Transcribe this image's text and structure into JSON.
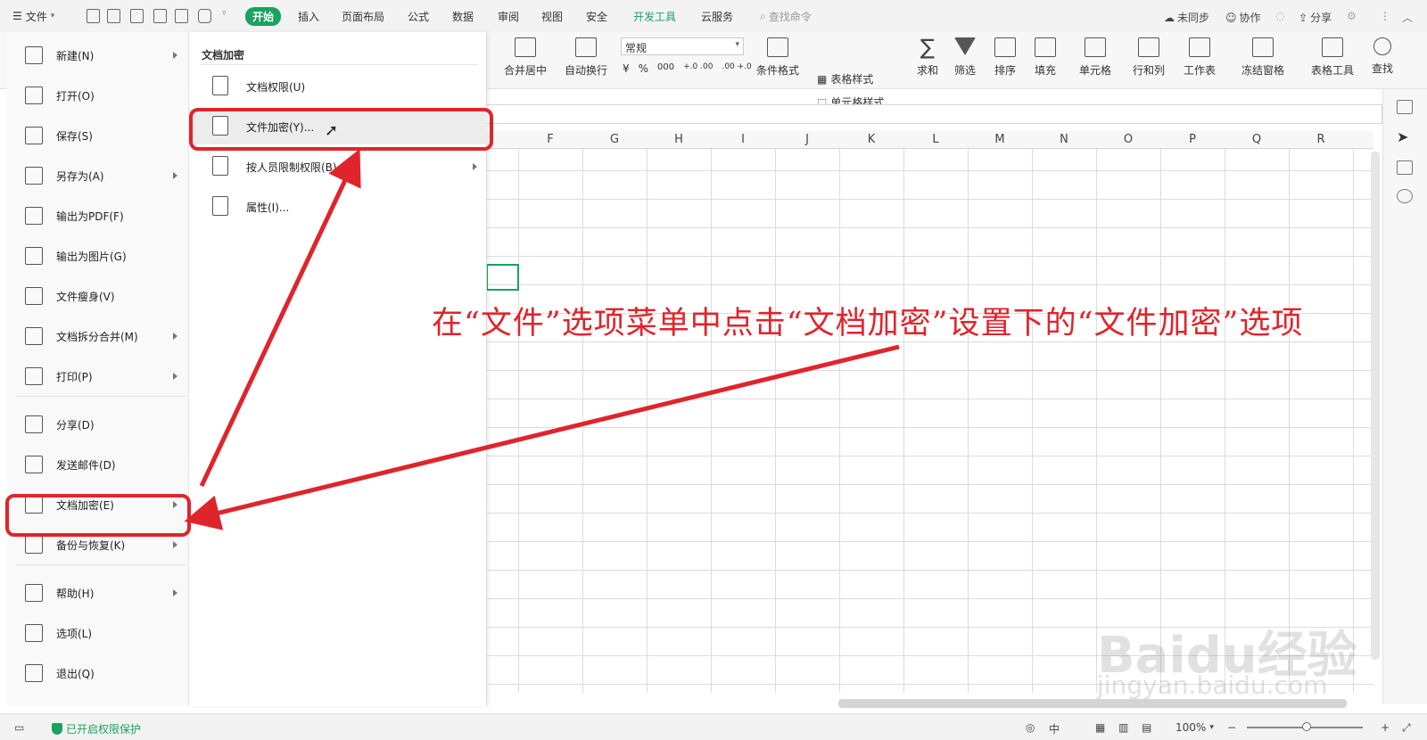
{
  "topbar": {
    "file_menu": "文件",
    "tabs": [
      "开始",
      "插入",
      "页面布局",
      "公式",
      "数据",
      "审阅",
      "视图",
      "安全",
      "开发工具",
      "云服务"
    ],
    "search_placeholder": "查找命令",
    "sync": "未同步",
    "collab": "协作",
    "share": "分享"
  },
  "ribbon": {
    "merge_center": "合并居中",
    "wrap": "自动换行",
    "format_value": "常规",
    "currency": "¥",
    "percent": "%",
    "thousands": "000",
    "dec_inc": "+.0 .00",
    "dec_dec": ".00 +.0",
    "cond_format": "条件格式",
    "table_style": "表格样式",
    "cell_style": "单元格样式",
    "sum": "求和",
    "filter": "筛选",
    "sort": "排序",
    "fill": "填充",
    "cell": "单元格",
    "row_col": "行和列",
    "sheet": "工作表",
    "freeze": "冻结窗格",
    "table_tools": "表格工具",
    "find": "查找"
  },
  "columns": [
    "F",
    "G",
    "H",
    "I",
    "J",
    "K",
    "L",
    "M",
    "N",
    "O",
    "P",
    "Q",
    "R"
  ],
  "left_menu": [
    {
      "label": "新建(N)",
      "icon": "new-file-icon",
      "arrow": true
    },
    {
      "label": "打开(O)",
      "icon": "folder-open-icon",
      "arrow": false
    },
    {
      "label": "保存(S)",
      "icon": "save-icon",
      "arrow": false
    },
    {
      "label": "另存为(A)",
      "icon": "save-as-icon",
      "arrow": true
    },
    {
      "label": "输出为PDF(F)",
      "icon": "pdf-icon",
      "arrow": false
    },
    {
      "label": "输出为图片(G)",
      "icon": "image-export-icon",
      "arrow": false
    },
    {
      "label": "文件瘦身(V)",
      "icon": "slim-file-icon",
      "arrow": false
    },
    {
      "label": "文档拆分合并(M)",
      "icon": "split-merge-icon",
      "arrow": true
    },
    {
      "label": "打印(P)",
      "icon": "print-icon",
      "arrow": true
    },
    {
      "label": "分享(D)",
      "icon": "share-icon",
      "arrow": false
    },
    {
      "label": "发送邮件(D)",
      "icon": "mail-icon",
      "arrow": false
    },
    {
      "label": "文档加密(E)",
      "icon": "doc-encrypt-icon",
      "arrow": true
    },
    {
      "label": "备份与恢复(K)",
      "icon": "backup-icon",
      "arrow": true
    },
    {
      "label": "帮助(H)",
      "icon": "help-icon",
      "arrow": true
    },
    {
      "label": "选项(L)",
      "icon": "gear-icon",
      "arrow": false
    },
    {
      "label": "退出(Q)",
      "icon": "exit-icon",
      "arrow": false
    }
  ],
  "submenu": {
    "title": "文档加密",
    "items": [
      {
        "label": "文档权限(U)",
        "icon": "doc-permission-icon",
        "arrow": false
      },
      {
        "label": "文件加密(Y)...",
        "icon": "file-encrypt-icon",
        "arrow": false
      },
      {
        "label": "按人员限制权限(B)",
        "icon": "restrict-user-icon",
        "arrow": true
      },
      {
        "label": "属性(I)...",
        "icon": "properties-icon",
        "arrow": false
      }
    ]
  },
  "annotation": "在“文件”选项菜单中点击“文档加密”设置下的“文件加密”选项",
  "statusbar": {
    "protection": "已开启权限保护",
    "zoom": "100%"
  },
  "watermark": {
    "brand": "Baidu经验",
    "url": "jingyan.baidu.com"
  },
  "colors": {
    "accent": "#1aa260",
    "highlight": "#e0242b"
  }
}
